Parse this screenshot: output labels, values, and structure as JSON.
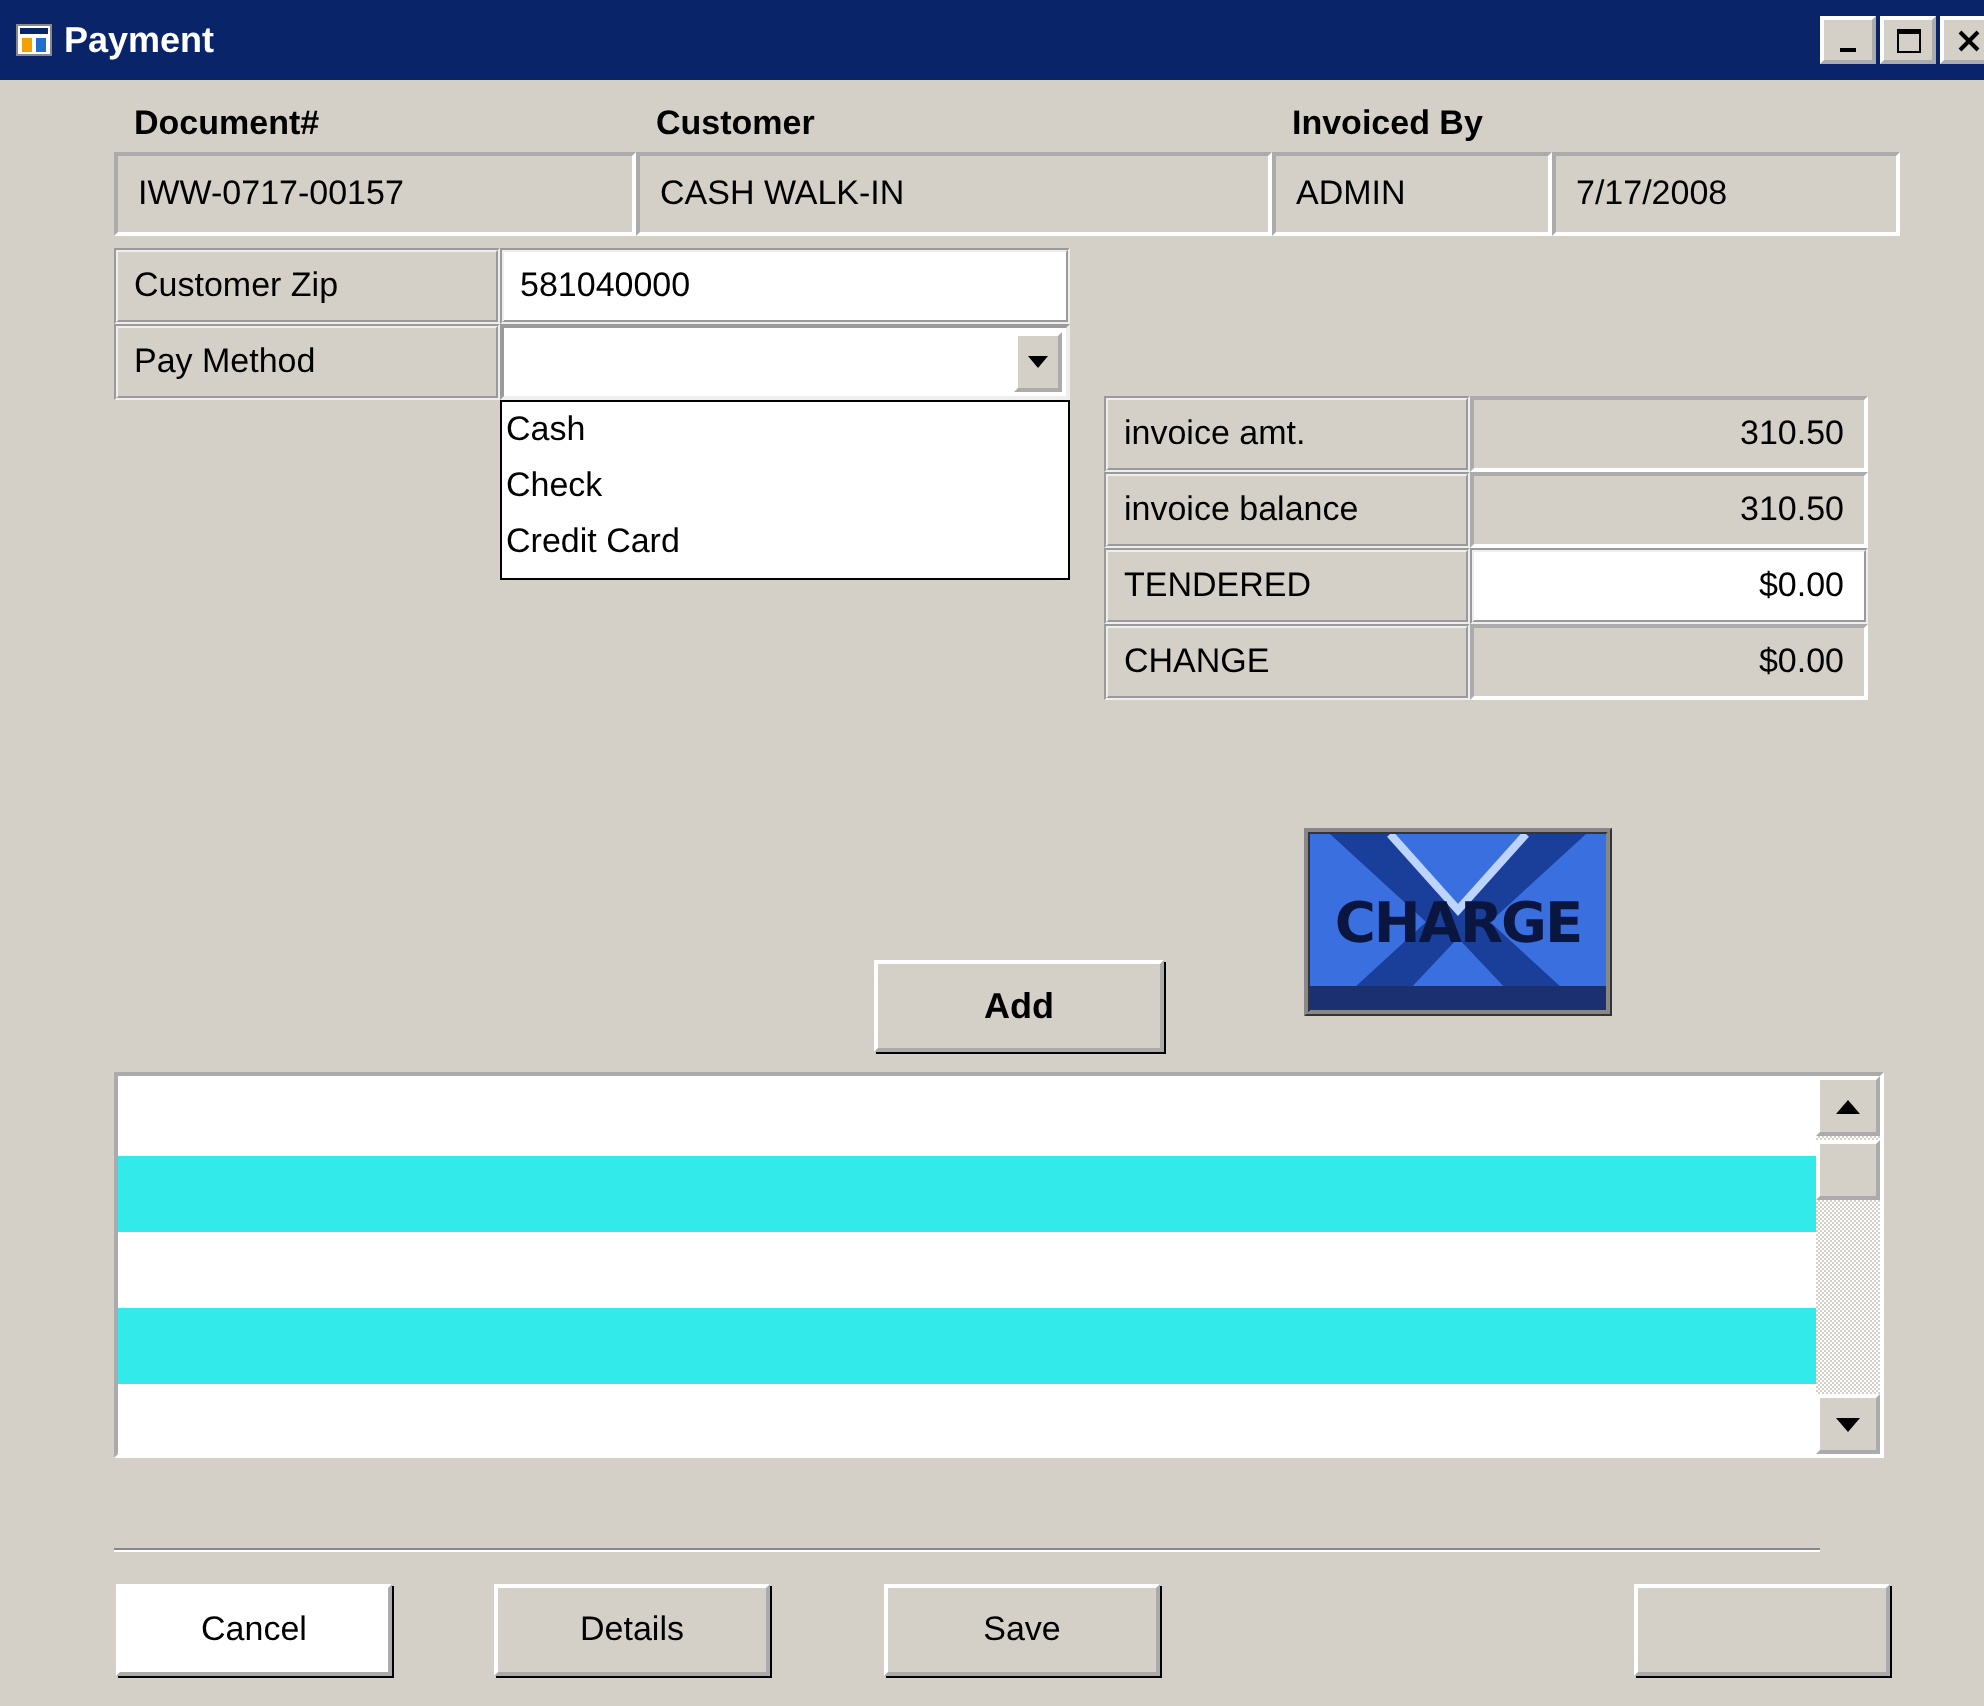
{
  "window": {
    "title": "Payment"
  },
  "header": {
    "columns": [
      {
        "label": "Document#"
      },
      {
        "label": "Customer"
      },
      {
        "label": "Invoiced By"
      }
    ],
    "values": [
      "IWW-0717-00157",
      "CASH WALK-IN",
      "ADMIN",
      "7/17/2008"
    ]
  },
  "customer_zip": {
    "label": "Customer Zip",
    "value": "581040000"
  },
  "pay_method": {
    "label": "Pay Method",
    "expanded": true,
    "options": [
      {
        "label": "Cash"
      },
      {
        "label": "Check"
      },
      {
        "label": "Credit Card"
      }
    ]
  },
  "totals": [
    {
      "label": "invoice amt.",
      "value": "310.50",
      "kind": "readonly"
    },
    {
      "label": "invoice balance",
      "value": "310.50",
      "kind": "readonly"
    },
    {
      "label": "TENDERED",
      "value": "$0.00",
      "kind": "input"
    },
    {
      "label": "CHANGE",
      "value": "$0.00",
      "kind": "readonly"
    }
  ],
  "logo": {
    "text": "CHARGE"
  },
  "add_button": {
    "label": "Add"
  },
  "payments_list": {
    "rows": [
      {
        "highlighted": false
      },
      {
        "highlighted": true
      },
      {
        "highlighted": false
      },
      {
        "highlighted": true
      },
      {
        "highlighted": false
      }
    ]
  },
  "buttons": [
    {
      "label": "Cancel",
      "default": true
    },
    {
      "label": "Details",
      "default": false
    },
    {
      "label": "Save",
      "default": false
    },
    {
      "default": false
    }
  ]
}
